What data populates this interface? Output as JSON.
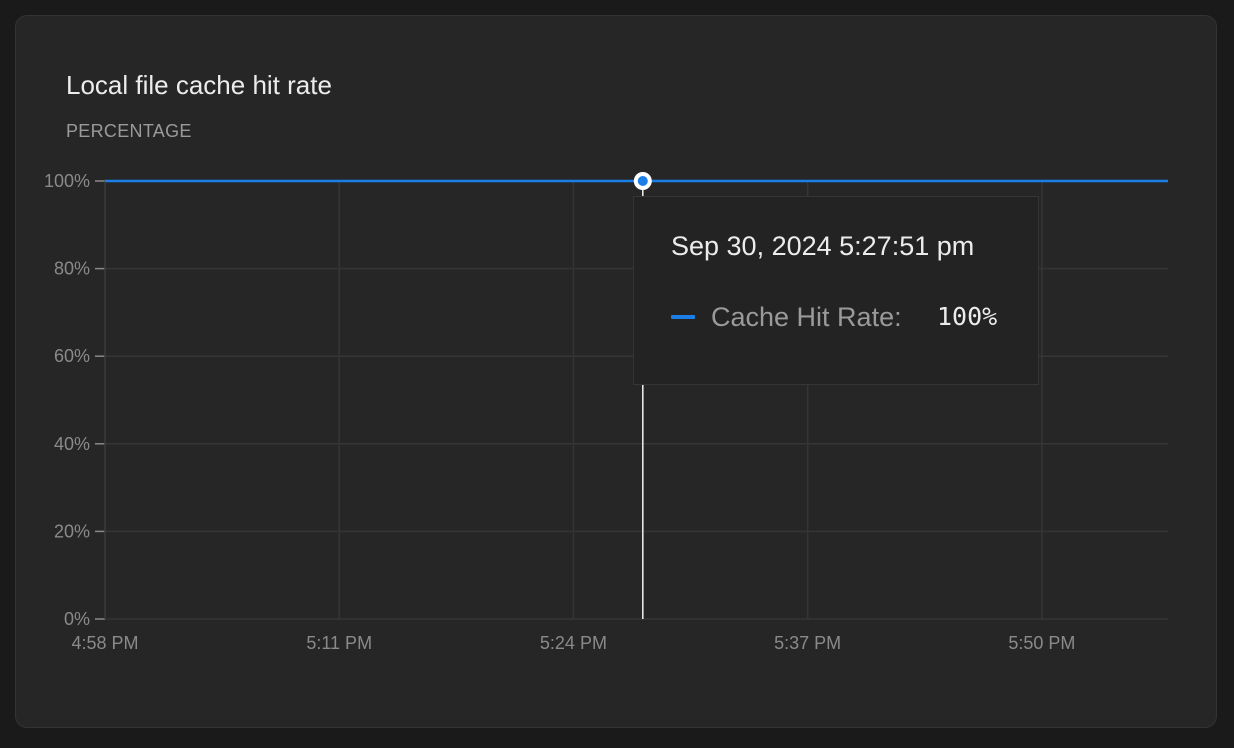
{
  "panel": {
    "title": "Local file cache hit rate",
    "unit_label": "PERCENTAGE"
  },
  "chart_data": {
    "type": "line",
    "title": "Local file cache hit rate",
    "ylabel": "PERCENTAGE",
    "xlabel": "",
    "x_ticks": [
      "4:58 PM",
      "5:11 PM",
      "5:24 PM",
      "5:37 PM",
      "5:50 PM"
    ],
    "x_range": [
      "4:58 PM",
      "5:57 PM"
    ],
    "y_ticks": [
      "0%",
      "20%",
      "40%",
      "60%",
      "80%",
      "100%"
    ],
    "ylim": [
      0,
      100
    ],
    "grid": true,
    "series": [
      {
        "name": "Cache Hit Rate",
        "color": "#1a7ee6",
        "x": [
          "4:58 PM",
          "5:57 PM"
        ],
        "y": [
          100,
          100
        ]
      }
    ],
    "hover": {
      "x": "5:27:51 PM",
      "y": 100
    }
  },
  "tooltip": {
    "date": "Sep 30, 2024 5:27:51 pm",
    "series_name": "Cache Hit Rate:",
    "value": "100%",
    "swatch_color": "#1a7ee6"
  }
}
